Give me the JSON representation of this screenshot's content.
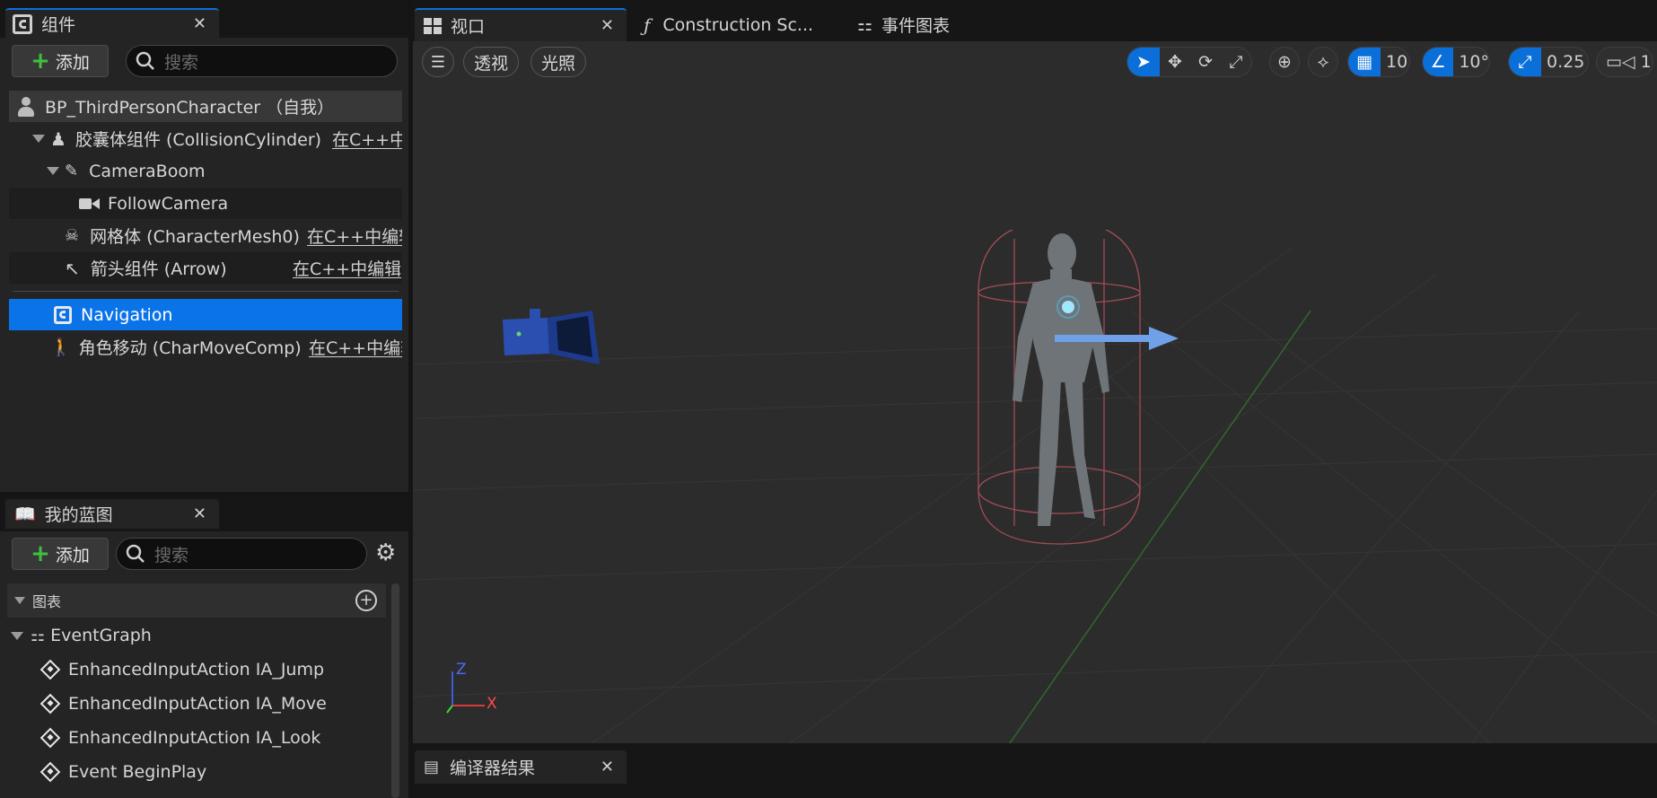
{
  "components_panel": {
    "tab_title": "组件",
    "add_label": "添加",
    "search_placeholder": "搜索",
    "root": "BP_ThirdPersonCharacter （自我）",
    "items": [
      {
        "label": "胶囊体组件 (CollisionCylinder)",
        "edit": "在C++中编辑"
      },
      {
        "label": "CameraBoom",
        "edit": ""
      },
      {
        "label": "FollowCamera",
        "edit": ""
      },
      {
        "label": "网格体 (CharacterMesh0)",
        "edit": "在C++中编辑"
      },
      {
        "label": "箭头组件 (Arrow)",
        "edit": "在C++中编辑"
      },
      {
        "label": "Navigation",
        "edit": ""
      },
      {
        "label": "角色移动 (CharMoveComp)",
        "edit": "在C++中编辑"
      }
    ]
  },
  "my_blueprint_panel": {
    "tab_title": "我的蓝图",
    "add_label": "添加",
    "search_placeholder": "搜索",
    "section_graphs": "图表",
    "event_graph": "EventGraph",
    "events": [
      "EnhancedInputAction IA_Jump",
      "EnhancedInputAction IA_Move",
      "EnhancedInputAction IA_Look",
      "Event BeginPlay"
    ]
  },
  "editor_tabs": [
    {
      "label": "视口"
    },
    {
      "label": "Construction Sc..."
    },
    {
      "label": "事件图表"
    }
  ],
  "viewport_toolbar": {
    "perspective": "透视",
    "lighting": "光照",
    "grid_snap": "10",
    "rotation_snap": "10°",
    "scale_snap": "0.25",
    "camera_speed": "1"
  },
  "axis_labels": {
    "z": "Z",
    "x": "X"
  },
  "bottom_tab": {
    "label": "编译器结果"
  },
  "colors": {
    "accent": "#0b6fd9",
    "selected_row": "#0b73e8",
    "background": "#242424",
    "viewport": "#2c2c2c"
  }
}
